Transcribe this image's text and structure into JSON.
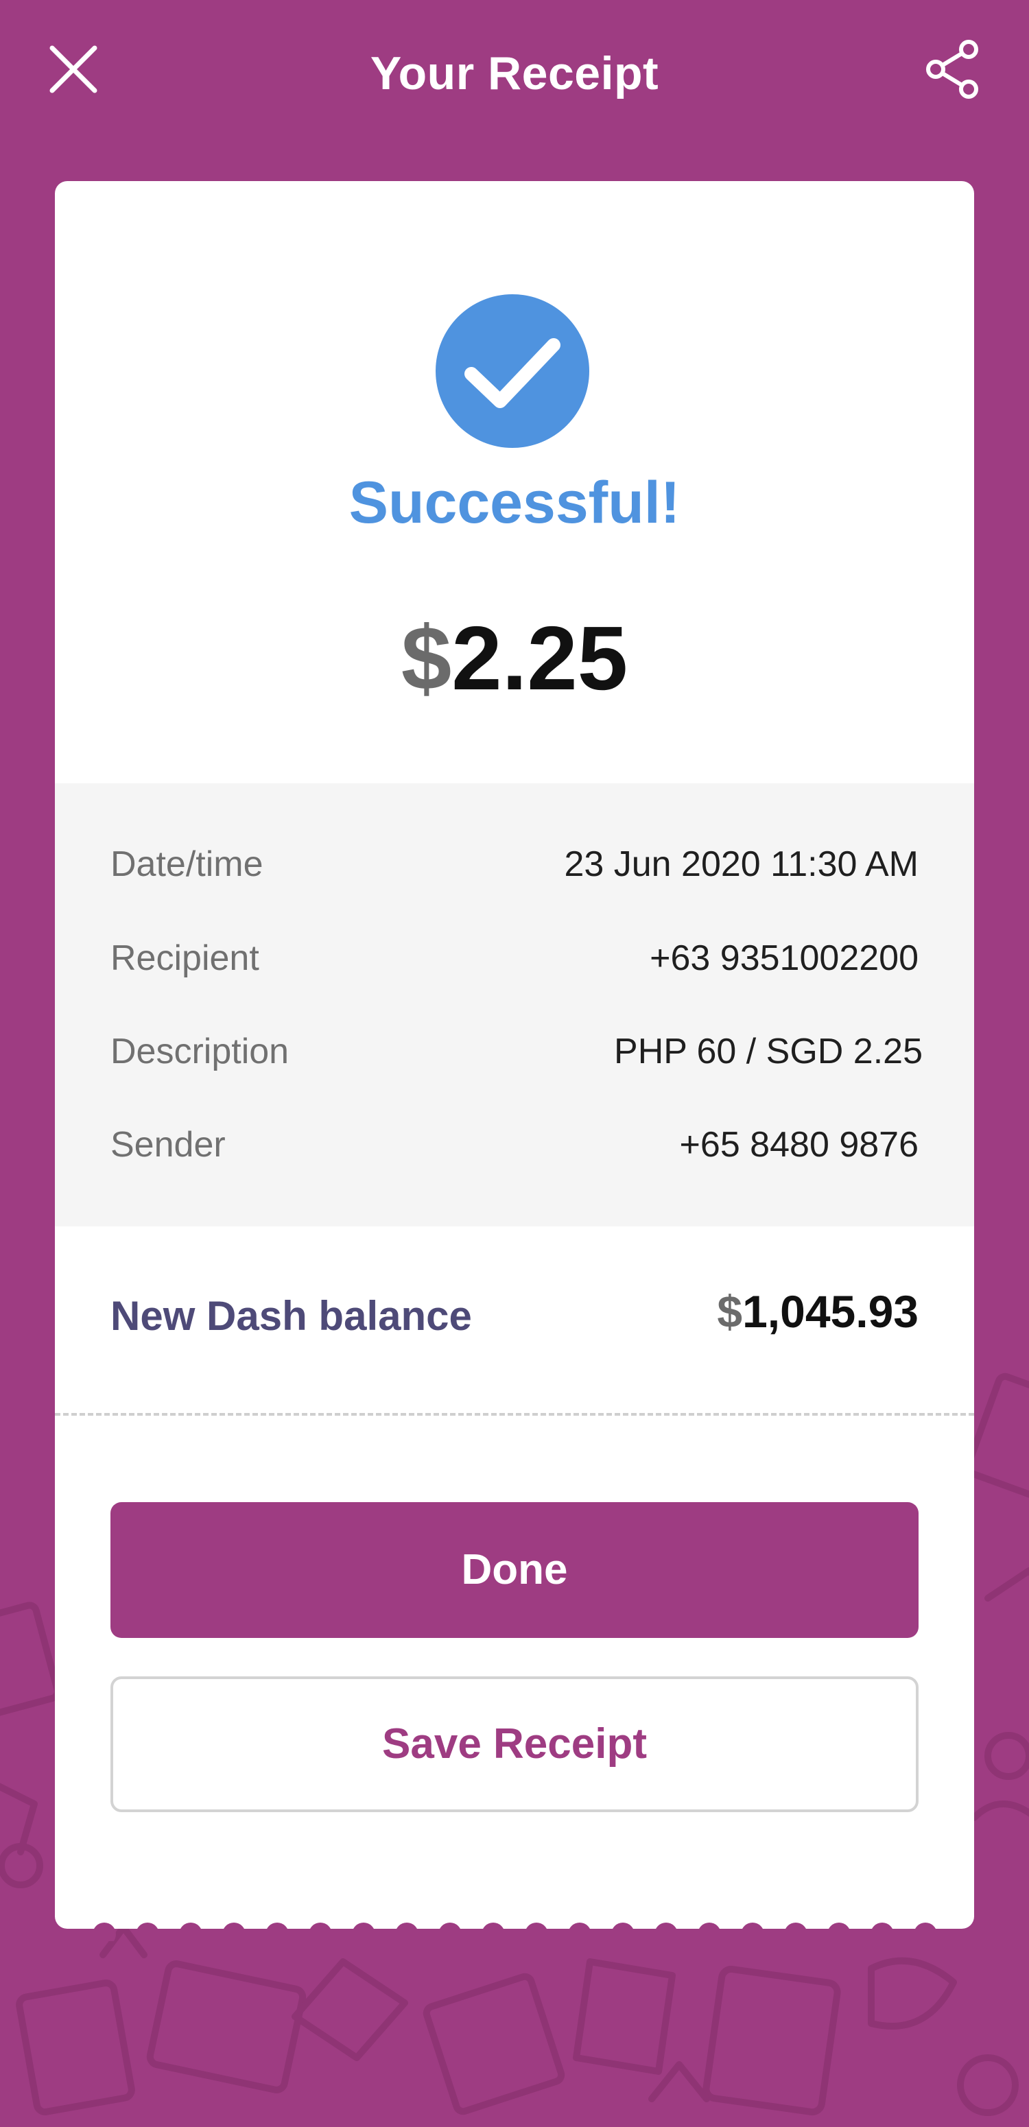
{
  "header": {
    "title": "Your Receipt",
    "close_icon": "close-icon",
    "share_icon": "share-icon"
  },
  "status": {
    "icon": "check-circle-icon",
    "text": "Successful!"
  },
  "amount": {
    "currency": "$",
    "value": "2.25"
  },
  "details": [
    {
      "label": "Date/time",
      "value": "23 Jun 2020 11:30 AM"
    },
    {
      "label": "Recipient",
      "value": "+63 9351002200"
    },
    {
      "label": "Description",
      "value": "PHP 60 / SGD 2.25"
    },
    {
      "label": "Sender",
      "value": "+65 8480 9876"
    }
  ],
  "balance": {
    "label": "New Dash balance",
    "currency": "$",
    "value": "1,045.93"
  },
  "actions": {
    "done_label": "Done",
    "save_label": "Save Receipt"
  },
  "colors": {
    "brand": "#9e3c82",
    "success": "#4f93df",
    "balance_label": "#4e4a78"
  }
}
